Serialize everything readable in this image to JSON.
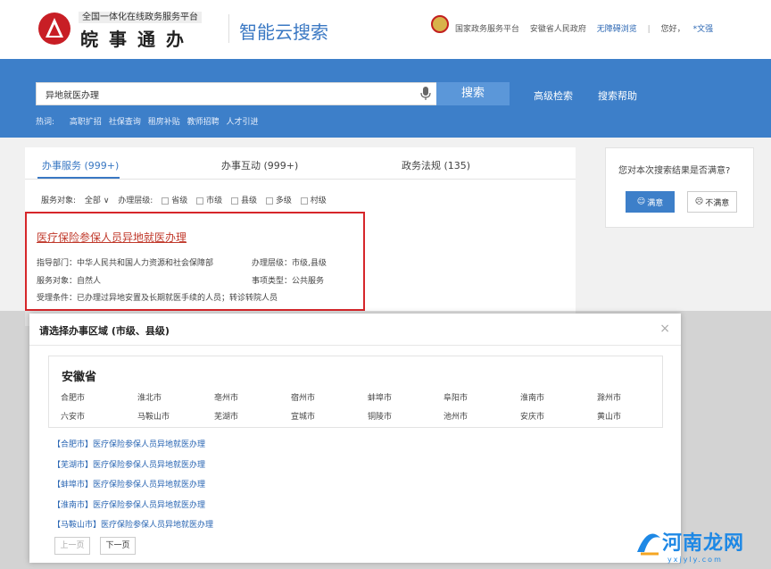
{
  "header": {
    "logo_sub": "全国一体化在线政务服务平台",
    "logo_main": "皖事通办",
    "cloud_title": "智能云搜索",
    "links": [
      "国家政务服务平台",
      "安徽省人民政府",
      "无障碍浏览"
    ],
    "greeting": "您好，",
    "username": "*文强"
  },
  "search": {
    "query": "异地就医办理",
    "button_label": "搜索",
    "advanced_label": "高级检索",
    "help_label": "搜索帮助",
    "hot_label": "热词:",
    "hot_words": [
      "高职扩招",
      "社保查询",
      "租房补贴",
      "教师招聘",
      "人才引进"
    ]
  },
  "tabs": [
    {
      "label": "办事服务 (999+)",
      "active": true
    },
    {
      "label": "办事互动 (999+)",
      "active": false
    },
    {
      "label": "政务法规 (135)",
      "active": false
    }
  ],
  "filters": {
    "target_label": "服务对象:",
    "target_value": "全部",
    "level_label": "办理层级:",
    "levels": [
      "省级",
      "市级",
      "县级",
      "多级",
      "村级"
    ]
  },
  "result": {
    "title_prefix": "医疗保险参保人员",
    "title_highlight": "异地就医办理",
    "dept": "指导部门：中华人民共和国人力资源和社会保障部",
    "level": "办理层级：市级,县级",
    "target": "服务对象：自然人",
    "type": "事项类型：公共服务",
    "condition": "受理条件：已办理过异地安置及长期就医手续的人员；转诊转院人员"
  },
  "satisfaction": {
    "question": "您对本次搜索结果是否满意?",
    "yes_label": "满意",
    "no_label": "不满意"
  },
  "modal": {
    "title": "请选择办事区域 (市级、县级)",
    "close_glyph": "×",
    "province": "安徽省",
    "cities_row1": [
      "合肥市",
      "淮北市",
      "亳州市",
      "宿州市",
      "蚌埠市",
      "阜阳市",
      "淮南市",
      "滁州市"
    ],
    "cities_row2": [
      "六安市",
      "马鞍山市",
      "芜湖市",
      "宣城市",
      "铜陵市",
      "池州市",
      "安庆市",
      "黄山市"
    ],
    "results": [
      "【合肥市】医疗保险参保人员异地就医办理",
      "【芜湖市】医疗保险参保人员异地就医办理",
      "【蚌埠市】医疗保险参保人员异地就医办理",
      "【淮南市】医疗保险参保人员异地就医办理",
      "【马鞍山市】医疗保险参保人员异地就医办理"
    ],
    "prev_label": "上一页",
    "next_label": "下一页"
  },
  "watermark": {
    "text": "河南龙网",
    "url": "yxjyly.com"
  },
  "colors": {
    "brand_blue": "#3d7fc9",
    "highlight_red": "#d6262a",
    "link_blue": "#2a66b3"
  }
}
